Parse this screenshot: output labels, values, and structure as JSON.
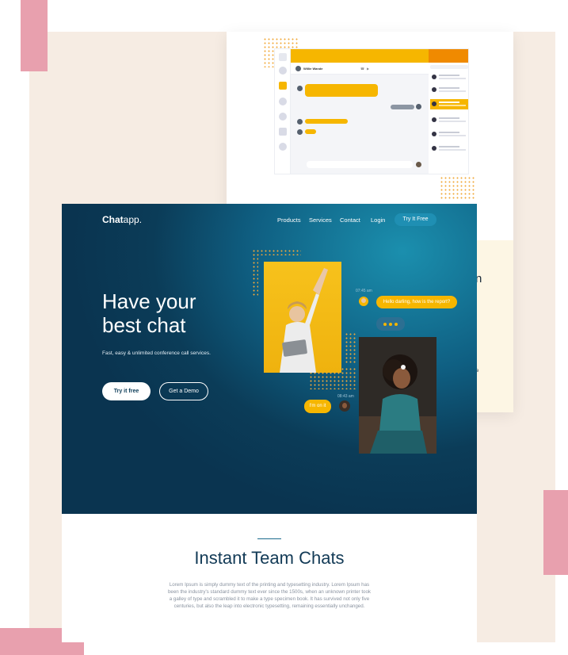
{
  "colors": {
    "accent_yellow": "#f6b600",
    "hero_dark": "#0a3450",
    "hero_light": "#1b8fae",
    "title_navy": "#123a56",
    "pink": "#e8a0ae",
    "cream": "#f6ece3"
  },
  "preview": {
    "contact_name": "Willie Wande",
    "partial_text_right_1": "n",
    "partial_text_right_2": "se"
  },
  "hero": {
    "logo_bold": "Chat",
    "logo_light": "app.",
    "nav": [
      "Products",
      "Services",
      "Contact",
      "Login"
    ],
    "try_button": "Try It Free",
    "title": "Have your\nbest chat",
    "subtitle": "Fast, easy & unlimited conference call services.",
    "primary_button": "Try it free",
    "secondary_button": "Get a Demo",
    "chat": {
      "time_1": "07:45 am",
      "message_1": "Hello darling, how is the report?",
      "time_2": "08:43 am",
      "message_2": "I'm on it"
    }
  },
  "section": {
    "title": "Instant Team Chats",
    "body": "Lorem Ipsum is simply dummy text of the printing and typesetting industry. Lorem Ipsum has been the industry's standard dummy text ever since the 1500s, when an unknown printer took a galley of type and scrambled it to make a type specimen book. It has survived not only five centuries, but also the leap into electronic typesetting, remaining essentially unchanged."
  },
  "icons": [
    "home-icon",
    "chat-icon",
    "settings-icon",
    "file-icon",
    "phone-icon",
    "video-icon",
    "send-icon"
  ]
}
